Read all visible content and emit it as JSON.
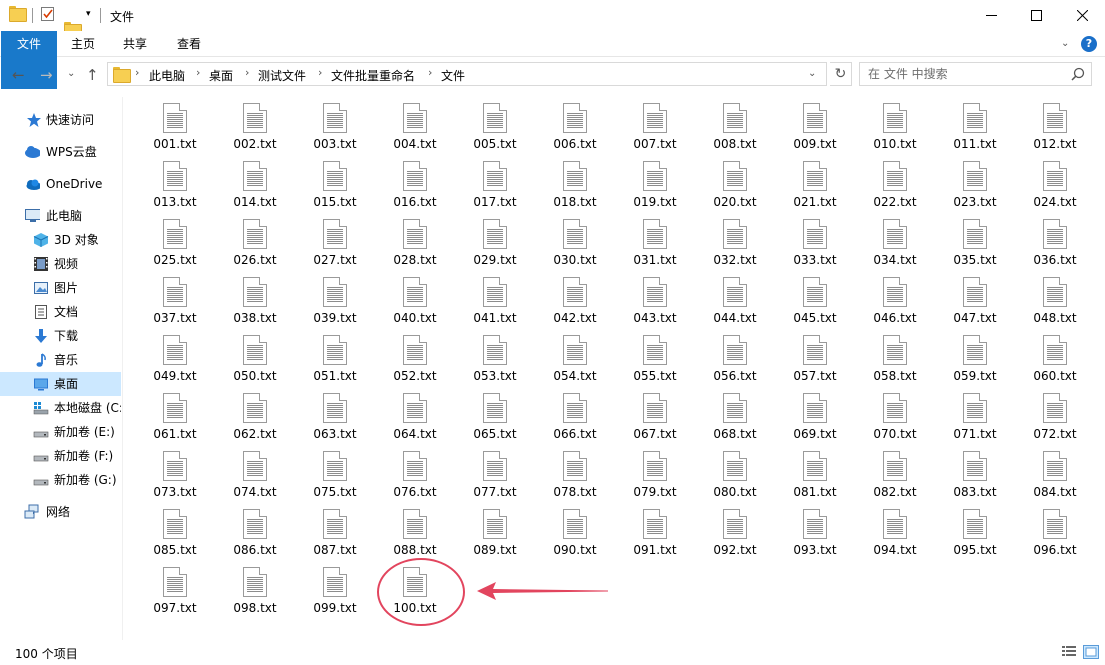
{
  "window": {
    "title": "文件"
  },
  "ribbon": {
    "tabs": [
      "文件",
      "主页",
      "共享",
      "查看"
    ]
  },
  "address": {
    "breadcrumbs": [
      "此电脑",
      "桌面",
      "测试文件",
      "文件批量重命名",
      "文件"
    ]
  },
  "search": {
    "placeholder": "在 文件 中搜索"
  },
  "sidebar": {
    "items": [
      {
        "label": "快速访问",
        "icon": "star-icon"
      },
      {
        "label": "WPS云盘",
        "icon": "cloud-icon"
      },
      {
        "label": "OneDrive",
        "icon": "onedrive-icon"
      },
      {
        "label": "此电脑",
        "icon": "computer-icon"
      },
      {
        "label": "3D 对象",
        "icon": "cube-icon"
      },
      {
        "label": "视频",
        "icon": "video-icon"
      },
      {
        "label": "图片",
        "icon": "picture-icon"
      },
      {
        "label": "文档",
        "icon": "document-icon"
      },
      {
        "label": "下载",
        "icon": "download-icon"
      },
      {
        "label": "音乐",
        "icon": "music-icon"
      },
      {
        "label": "桌面",
        "icon": "desktop-icon"
      },
      {
        "label": "本地磁盘 (C:",
        "icon": "drive-c-icon"
      },
      {
        "label": "新加卷 (E:)",
        "icon": "drive-icon"
      },
      {
        "label": "新加卷 (F:)",
        "icon": "drive-icon"
      },
      {
        "label": "新加卷 (G:)",
        "icon": "drive-icon"
      },
      {
        "label": "网络",
        "icon": "network-icon"
      }
    ],
    "selected": "桌面"
  },
  "files": {
    "names": [
      "001.txt",
      "002.txt",
      "003.txt",
      "004.txt",
      "005.txt",
      "006.txt",
      "007.txt",
      "008.txt",
      "009.txt",
      "010.txt",
      "011.txt",
      "012.txt",
      "013.txt",
      "014.txt",
      "015.txt",
      "016.txt",
      "017.txt",
      "018.txt",
      "019.txt",
      "020.txt",
      "021.txt",
      "022.txt",
      "023.txt",
      "024.txt",
      "025.txt",
      "026.txt",
      "027.txt",
      "028.txt",
      "029.txt",
      "030.txt",
      "031.txt",
      "032.txt",
      "033.txt",
      "034.txt",
      "035.txt",
      "036.txt",
      "037.txt",
      "038.txt",
      "039.txt",
      "040.txt",
      "041.txt",
      "042.txt",
      "043.txt",
      "044.txt",
      "045.txt",
      "046.txt",
      "047.txt",
      "048.txt",
      "049.txt",
      "050.txt",
      "051.txt",
      "052.txt",
      "053.txt",
      "054.txt",
      "055.txt",
      "056.txt",
      "057.txt",
      "058.txt",
      "059.txt",
      "060.txt",
      "061.txt",
      "062.txt",
      "063.txt",
      "064.txt",
      "065.txt",
      "066.txt",
      "067.txt",
      "068.txt",
      "069.txt",
      "070.txt",
      "071.txt",
      "072.txt",
      "073.txt",
      "074.txt",
      "075.txt",
      "076.txt",
      "077.txt",
      "078.txt",
      "079.txt",
      "080.txt",
      "081.txt",
      "082.txt",
      "083.txt",
      "084.txt",
      "085.txt",
      "086.txt",
      "087.txt",
      "088.txt",
      "089.txt",
      "090.txt",
      "091.txt",
      "092.txt",
      "093.txt",
      "094.txt",
      "095.txt",
      "096.txt",
      "097.txt",
      "098.txt",
      "099.txt",
      "100.txt"
    ],
    "highlighted": "100.txt"
  },
  "status": {
    "item_count": "100 个项目"
  },
  "colors": {
    "accent": "#1979ca",
    "selection": "#cce8ff",
    "annotation": "#e2455e"
  }
}
